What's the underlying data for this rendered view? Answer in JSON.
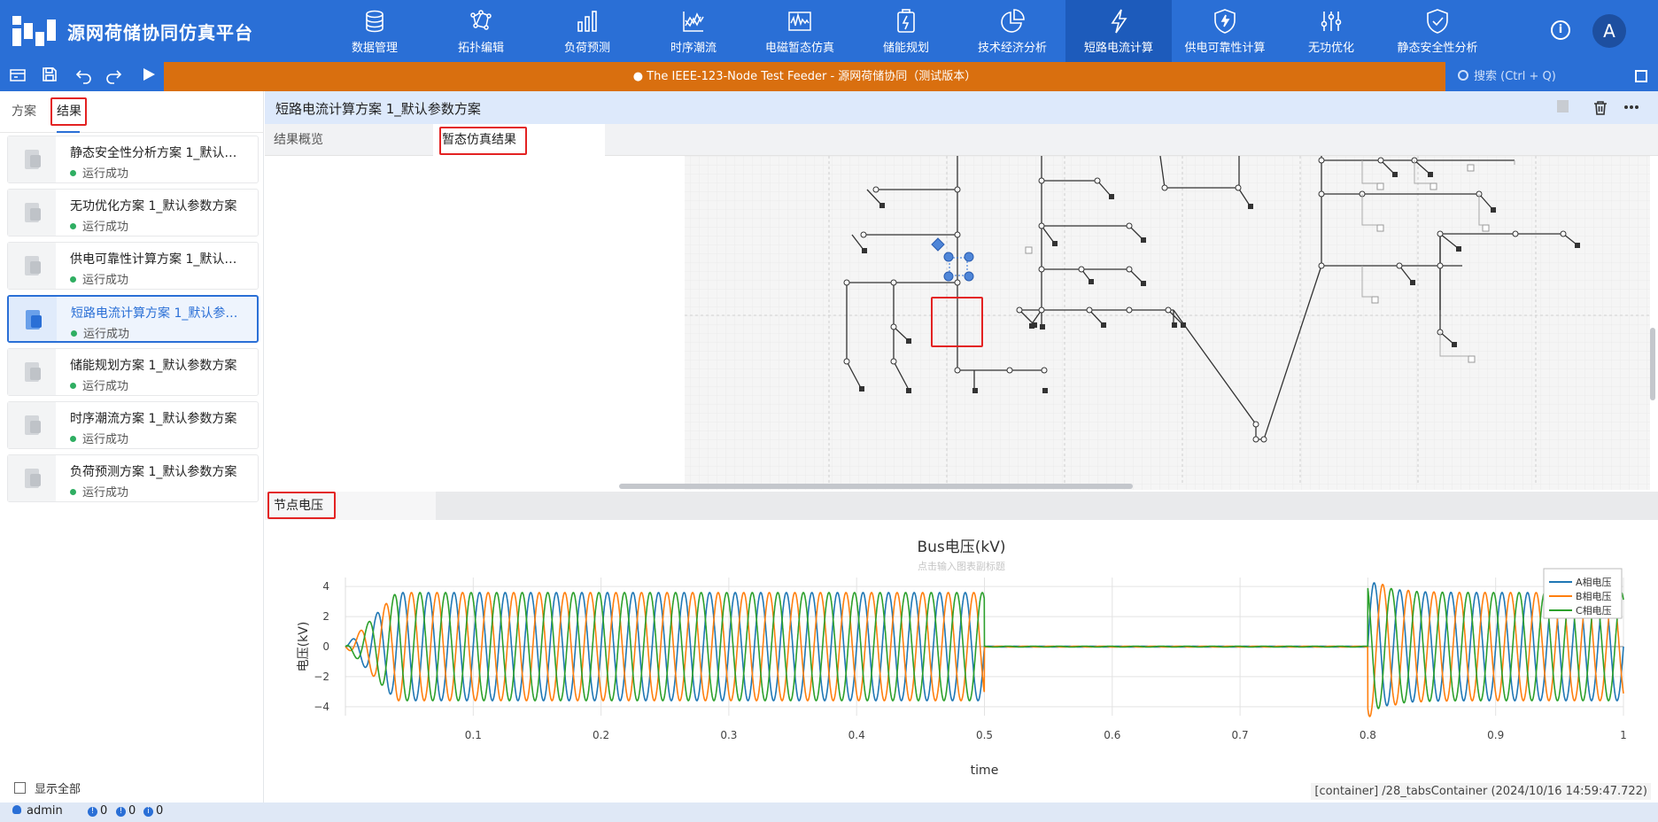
{
  "app": {
    "title": "源网荷储协同仿真平台",
    "avatar_letter": "A",
    "info_symbol": "i"
  },
  "nav": [
    {
      "label": "数据管理",
      "icon": "database-icon"
    },
    {
      "label": "拓扑编辑",
      "icon": "topology-icon"
    },
    {
      "label": "负荷预测",
      "icon": "bar-chart-icon"
    },
    {
      "label": "时序潮流",
      "icon": "line-chart-icon"
    },
    {
      "label": "电磁暂态仿真",
      "icon": "waveform-icon"
    },
    {
      "label": "储能规划",
      "icon": "battery-icon"
    },
    {
      "label": "技术经济分析",
      "icon": "pie-chart-icon"
    },
    {
      "label": "短路电流计算",
      "icon": "lightning-icon",
      "active": true
    },
    {
      "label": "供电可靠性计算",
      "icon": "shield-bolt-icon"
    },
    {
      "label": "无功优化",
      "icon": "sliders-icon"
    },
    {
      "label": "静态安全性分析",
      "icon": "shield-check-icon"
    }
  ],
  "toolbar": {
    "title": "● The IEEE-123-Node Test Feeder - 源网荷储协同（测试版本）",
    "search_placeholder": "搜索 (Ctrl + Q)"
  },
  "left": {
    "tab_plan": "方案",
    "tab_result": "结果",
    "show_all": "显示全部",
    "plans": [
      {
        "name": "静态安全性分析方案 1_默认参数方案",
        "status": "运行成功"
      },
      {
        "name": "无功优化方案 1_默认参数方案",
        "status": "运行成功"
      },
      {
        "name": "供电可靠性计算方案 1_默认参数方案",
        "status": "运行成功"
      },
      {
        "name": "短路电流计算方案 1_默认参数方案",
        "status": "运行成功",
        "active": true
      },
      {
        "name": "储能规划方案 1_默认参数方案",
        "status": "运行成功"
      },
      {
        "name": "时序潮流方案 1_默认参数方案",
        "status": "运行成功"
      },
      {
        "name": "负荷预测方案 1_默认参数方案",
        "status": "运行成功"
      }
    ]
  },
  "main": {
    "title": "短路电流计算方案 1_默认参数方案",
    "tab_overview": "结果概览",
    "tab_transient": "暂态仿真结果",
    "voltage_tab": "节点电压",
    "container_path": "[container] /28_tabsContainer (2024/10/16 14:59:47.722)"
  },
  "status": {
    "user": "admin",
    "errors": "0",
    "warnings": "0",
    "infos": "0"
  },
  "chart_data": {
    "type": "line",
    "title": "Bus电压(kV)",
    "subtitle": "点击输入图表副标题",
    "xlabel": "time",
    "ylabel": "电压(kV)",
    "xlim": [
      0.0,
      1.0
    ],
    "ylim": [
      -4.6,
      4.6
    ],
    "xticks": [
      "0.1",
      "0.2",
      "0.3",
      "0.4",
      "0.5",
      "0.6",
      "0.7",
      "0.8",
      "0.9",
      "1"
    ],
    "yticks": [
      "4",
      "2",
      "0",
      "−2",
      "−4"
    ],
    "legend_position": "top-right",
    "frequency_hz": 50,
    "fault_interval": [
      0.5,
      0.8
    ],
    "series": [
      {
        "name": "A相电压",
        "color": "#1f77b4",
        "amplitude": 3.6,
        "phase_deg": 0
      },
      {
        "name": "B相电压",
        "color": "#ff7f0e",
        "amplitude": 3.6,
        "phase_deg": -120
      },
      {
        "name": "C相电压",
        "color": "#2ca02c",
        "amplitude": 3.6,
        "phase_deg": 120
      }
    ]
  }
}
